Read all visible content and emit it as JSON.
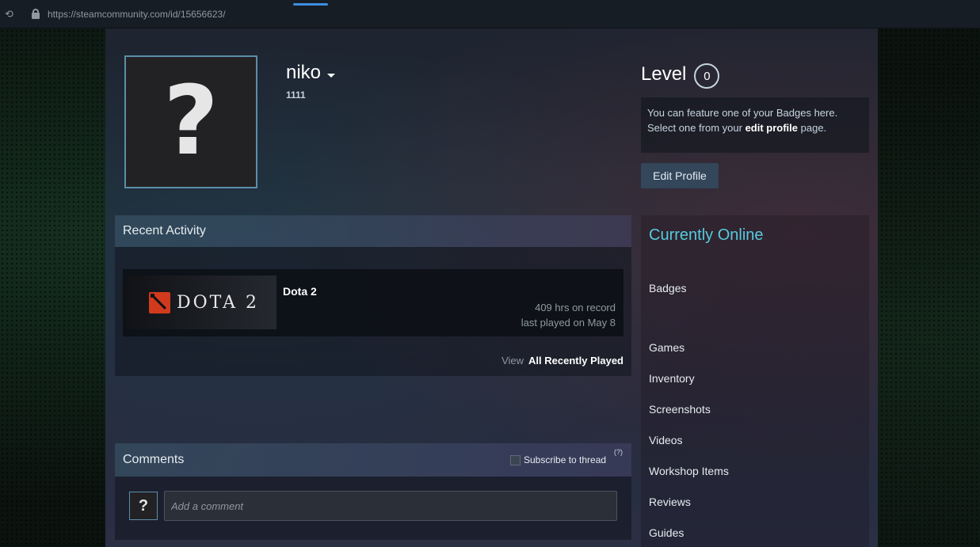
{
  "browser": {
    "url": "https://steamcommunity.com/id/15656623/"
  },
  "profile": {
    "avatar_glyph": "?",
    "persona_name": "niko",
    "real_name": "1111"
  },
  "level": {
    "label": "Level",
    "value": "0"
  },
  "badge_box": {
    "line1": "You can feature one of your Badges here.",
    "line2_prefix": "Select one from your ",
    "line2_link": "edit profile",
    "line2_suffix": " page."
  },
  "edit_profile_label": "Edit Profile",
  "recent_activity": {
    "title": "Recent Activity",
    "game": {
      "logo_text": "DOTA 2",
      "name": "Dota 2",
      "hours": "409 hrs on record",
      "last_played": "last played on May 8"
    },
    "view_prefix": "View",
    "view_link": "All Recently Played"
  },
  "comments": {
    "title": "Comments",
    "subscribe_label": "Subscribe to thread",
    "help": "(?)",
    "avatar_glyph": "?",
    "placeholder": "Add a comment"
  },
  "sidebar": {
    "status": "Currently Online",
    "links": [
      "Badges",
      "Games",
      "Inventory",
      "Screenshots",
      "Videos",
      "Workshop Items",
      "Reviews",
      "Guides"
    ]
  },
  "colors": {
    "online_blue": "#57cbde",
    "accent": "#3d8ee0",
    "dota_red": "#d23a1d"
  }
}
